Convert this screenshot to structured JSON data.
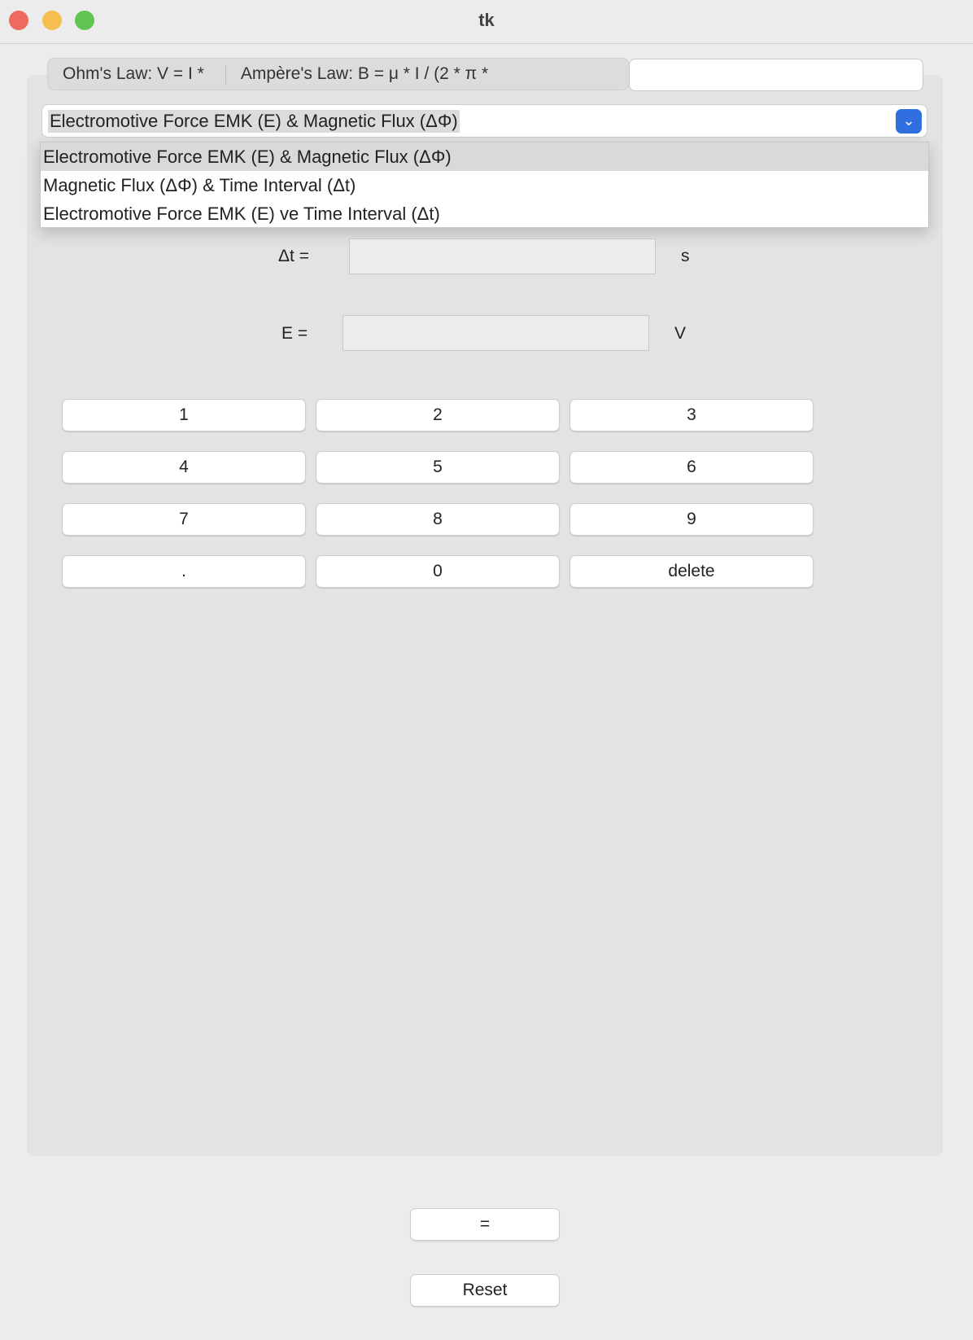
{
  "window": {
    "title": "tk"
  },
  "colors": {
    "close": "#ee6a5e",
    "minimize": "#f5be4f",
    "zoom": "#61c554",
    "accent": "#2f6fe0"
  },
  "tabs": [
    {
      "label": "Ohm's Law: V = I *"
    },
    {
      "label": "Ampère's Law: B = μ * I / (2 * π *"
    }
  ],
  "tab_entry": {
    "value": ""
  },
  "combo": {
    "selected": "Electromotive Force EMK (E) & Magnetic Flux (ΔΦ)",
    "icon": "chevron-down-icon",
    "options": [
      "Electromotive Force EMK (E) & Magnetic Flux (ΔΦ)",
      "Magnetic Flux (ΔΦ) & Time Interval (Δt)",
      "Electromotive Force EMK (E) ve Time Interval (Δt)"
    ]
  },
  "fields": [
    {
      "label": "Δt =",
      "value": "",
      "unit": "s"
    },
    {
      "label": "E =",
      "value": "",
      "unit": "V"
    }
  ],
  "keypad": [
    "1",
    "2",
    "3",
    "4",
    "5",
    "6",
    "7",
    "8",
    "9",
    ".",
    "0",
    "delete"
  ],
  "equals_label": "=",
  "reset_label": "Reset"
}
